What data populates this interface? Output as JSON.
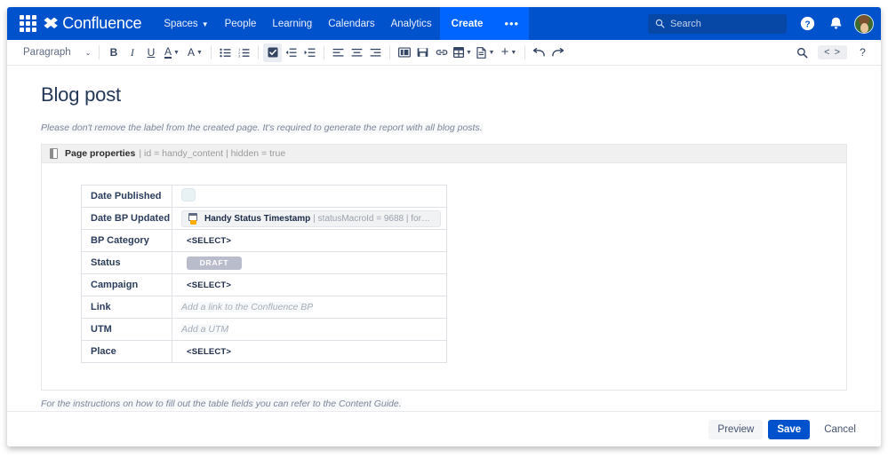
{
  "topnav": {
    "appswitcher_label": "App switcher",
    "brand": "Confluence",
    "items": [
      {
        "label": "Spaces",
        "has_caret": true
      },
      {
        "label": "People",
        "has_caret": false
      },
      {
        "label": "Learning",
        "has_caret": false
      },
      {
        "label": "Calendars",
        "has_caret": false
      },
      {
        "label": "Analytics",
        "has_caret": false
      }
    ],
    "create_label": "Create",
    "more_label": "•••",
    "search_placeholder": "Search",
    "help_label": "?",
    "notifications_label": "Notifications"
  },
  "toolbar": {
    "style_label": "Paragraph",
    "caret": "⌄",
    "bold": "B",
    "italic": "I",
    "underline": "U",
    "text_color": "A",
    "text_highlight": "A",
    "bullet_list": "≔",
    "numbered_list": "≕",
    "task_list": "☑",
    "outdent": "⇤",
    "indent": "⇥",
    "align_left": "≡",
    "align_center": "≡",
    "align_right": "≡",
    "page_layout": "▥",
    "insert_image": "▤",
    "insert_link": "🔗",
    "insert_table": "⊞",
    "insert_template": "🗎",
    "insert_more": "+",
    "undo": "↶",
    "redo": "↷",
    "find_replace": "⌕",
    "source_code": "< >",
    "help": "?"
  },
  "document": {
    "title": "Blog post",
    "top_note": "Please  don't remove the label from the created page. It's required to generate the report with all blog posts.",
    "bottom_note": "For the instructions on how to fill out the table fields you can refer to the Content Guide."
  },
  "macro": {
    "title": "Page properties",
    "params": "| id = handy_content | hidden = true"
  },
  "properties_table": {
    "rows": [
      {
        "key": "Date Published",
        "type": "blue-chip",
        "value": ""
      },
      {
        "key": "Date BP Updated",
        "type": "macro-chip",
        "value": "Handy Status Timestamp",
        "params": "| statusMacroId = 9688 | form…"
      },
      {
        "key": "BP Category",
        "type": "select",
        "value": "<SELECT>"
      },
      {
        "key": "Status",
        "type": "status",
        "value": "DRAFT"
      },
      {
        "key": "Campaign",
        "type": "select",
        "value": "<SELECT>"
      },
      {
        "key": "Link",
        "type": "placeholder",
        "value": "Add a link to the Confluence BP"
      },
      {
        "key": "UTM",
        "type": "placeholder",
        "value": "Add  a UTM"
      },
      {
        "key": "Place",
        "type": "select",
        "value": "<SELECT>"
      }
    ]
  },
  "footer": {
    "preview_label": "Preview",
    "save_label": "Save",
    "cancel_label": "Cancel"
  },
  "colors": {
    "nav_blue": "#0052cc",
    "create_blue": "#0065ff",
    "search_blue": "#0747a6",
    "primary_button": "#0052cc",
    "status_badge": "#b9bdcb",
    "macro_header": "#f0f0f0"
  }
}
